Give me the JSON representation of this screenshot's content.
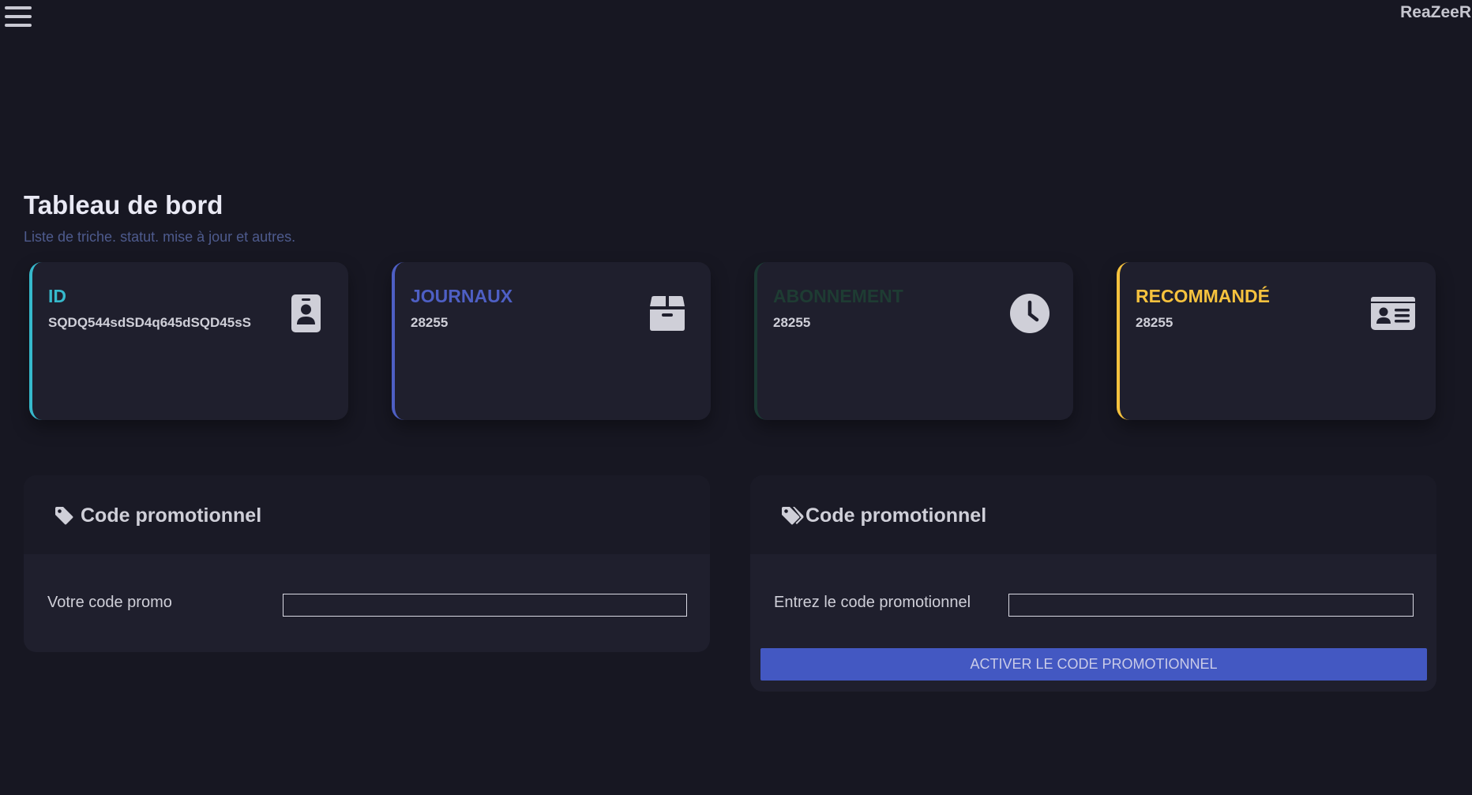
{
  "header": {
    "menu_icon": "hamburger-menu-icon",
    "brand": "ReaZeeR"
  },
  "dashboard": {
    "title": "Tableau de bord",
    "subtitle": "Liste de triche. statut. mise à jour et autres."
  },
  "cards": [
    {
      "label": "ID",
      "value": "SQDQ544sdSD4q645dSQD45sS",
      "icon": "id-badge-icon",
      "color": "#36b9cc"
    },
    {
      "label": "JOURNAUX",
      "value": "28255",
      "icon": "box-icon",
      "color": "#4e5fc4"
    },
    {
      "label": "ABONNEMENT",
      "value": "28255",
      "icon": "clock-icon",
      "color": "#1e3c33"
    },
    {
      "label": "RECOMMANDÉ",
      "value": "28255",
      "icon": "id-card-icon",
      "color": "#f6c23e"
    }
  ],
  "promo_left": {
    "title": "Code promotionnel",
    "icon": "tag-icon",
    "field_label": "Votre code promo",
    "field_value": ""
  },
  "promo_right": {
    "title": "Code promotionnel",
    "icon": "tags-icon",
    "field_label": "Entrez le code promotionnel",
    "field_value": "",
    "button_label": "ACTIVER LE CODE PROMOTIONNEL"
  },
  "colors": {
    "background": "#171722",
    "card": "#1f1f2d",
    "primary_button": "#4358c2"
  }
}
